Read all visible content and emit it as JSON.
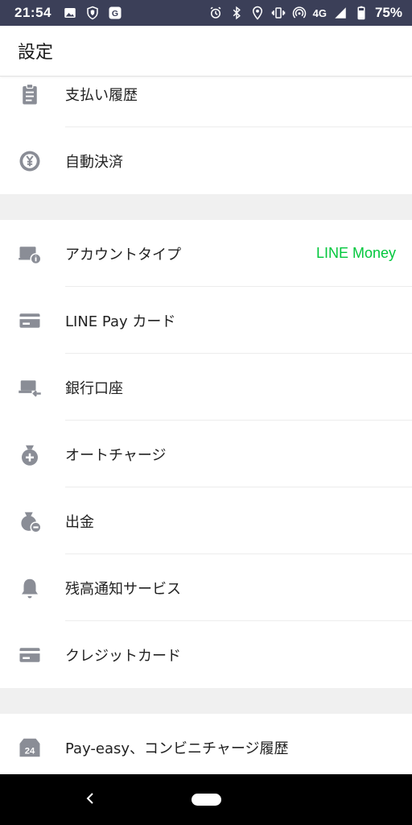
{
  "status_bar": {
    "time": "21:54",
    "network": "4G",
    "battery": "75%",
    "left_icons": [
      "image-icon",
      "shield-icon",
      "g-app-icon"
    ],
    "right_icons": [
      "alarm-icon",
      "bluetooth-icon",
      "location-icon",
      "vibrate-icon",
      "hotspot-icon",
      "signal-icon",
      "battery-icon"
    ]
  },
  "app_bar": {
    "title": "設定"
  },
  "settings": {
    "payment_history": {
      "label": "支払い履歴",
      "icon": "clipboard-icon"
    },
    "auto_payment": {
      "label": "自動決済",
      "icon": "yen-coin-icon"
    },
    "account_type": {
      "label": "アカウントタイプ",
      "value": "LINE Money",
      "icon": "account-type-icon"
    },
    "line_pay_card": {
      "label": "LINE Pay カード",
      "icon": "card-icon"
    },
    "bank_account": {
      "label": "銀行口座",
      "icon": "bank-account-icon"
    },
    "auto_charge": {
      "label": "オートチャージ",
      "icon": "money-bag-plus-icon"
    },
    "withdraw": {
      "label": "出金",
      "icon": "money-bag-minus-icon"
    },
    "balance_notice": {
      "label": "残高通知サービス",
      "icon": "bell-icon"
    },
    "credit_card": {
      "label": "クレジットカード",
      "icon": "card-icon"
    },
    "payeasy_history": {
      "label": "Pay-easy、コンビニチャージ履歴",
      "icon": "store-24-icon"
    }
  },
  "colors": {
    "status_bar": "#3b3f58",
    "accent_green": "#00c73c",
    "icon_gray": "#8a8d96",
    "section_gap": "#f0f0f0"
  },
  "nav_bar": {
    "back": "back-icon",
    "home": "home-pill"
  }
}
